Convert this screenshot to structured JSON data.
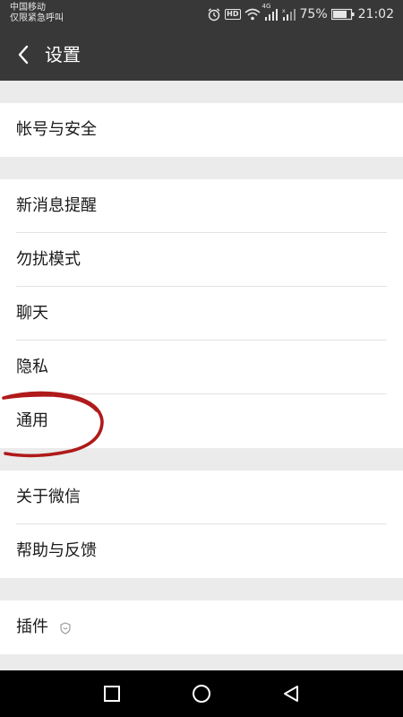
{
  "status_bar": {
    "carrier": "中国移动",
    "emergency": "仅限紧急呼叫",
    "hd": "HD",
    "network": "4G",
    "battery": "75%",
    "time": "21:02"
  },
  "header": {
    "title": "设置"
  },
  "settings": {
    "group1": [
      "帐号与安全"
    ],
    "group2": [
      "新消息提醒",
      "勿扰模式",
      "聊天",
      "隐私",
      "通用"
    ],
    "group3": [
      "关于微信",
      "帮助与反馈"
    ],
    "group4": [
      "插件"
    ]
  },
  "annotation": {
    "color": "#b01a1a",
    "target": "通用"
  },
  "colors": {
    "header_bg": "#383838",
    "page_bg": "#ebebeb",
    "row_bg": "#ffffff"
  }
}
